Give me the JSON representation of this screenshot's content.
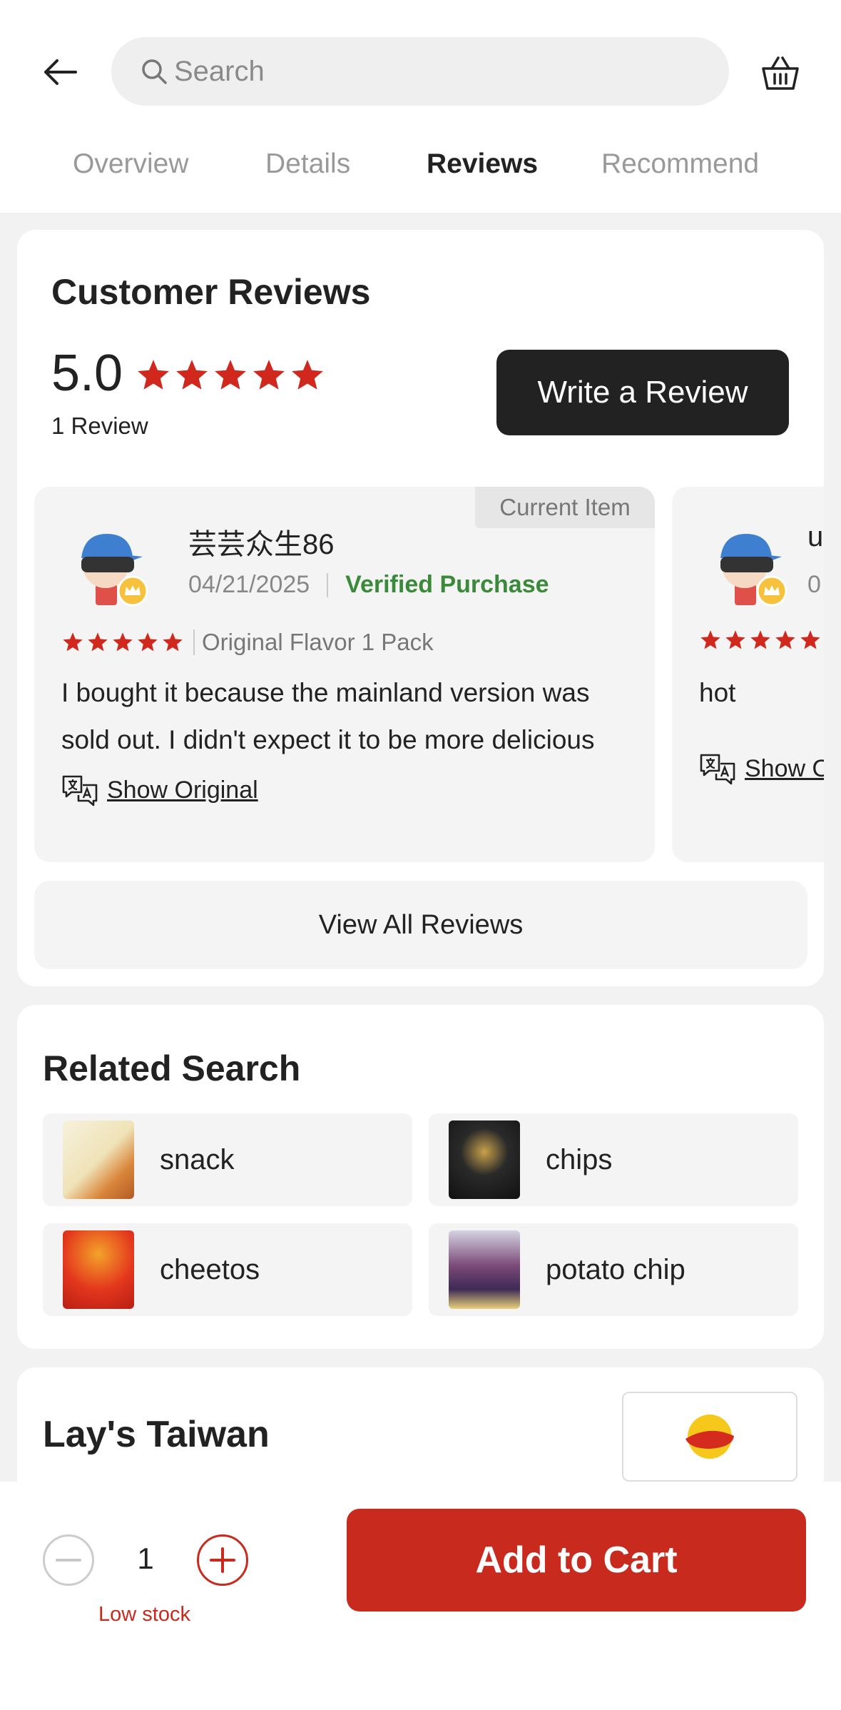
{
  "header": {
    "search_placeholder": "Search",
    "tabs": [
      {
        "label": "Overview",
        "active": false
      },
      {
        "label": "Details",
        "active": false
      },
      {
        "label": "Reviews",
        "active": true
      },
      {
        "label": "Recommend",
        "active": false
      }
    ]
  },
  "reviews": {
    "title": "Customer Reviews",
    "rating": "5.0",
    "rating_stars": 5,
    "count_label": "1 Review",
    "write_button": "Write a Review",
    "items": [
      {
        "tag": "Current Item",
        "name": "芸芸众生86",
        "date": "04/21/2025",
        "verified": "Verified Purchase",
        "stars": 5,
        "variant": "Original Flavor 1 Pack",
        "text": "I bought it because the mainland version was sold out. I didn't expect it to be more delicious",
        "show_original": "Show Original"
      },
      {
        "name": "u",
        "date": "0",
        "stars": 5,
        "text": "hot",
        "show_original": "Show O"
      }
    ],
    "view_all": "View All Reviews"
  },
  "related_search": {
    "title": "Related Search",
    "items": [
      {
        "label": "snack"
      },
      {
        "label": "chips"
      },
      {
        "label": "cheetos"
      },
      {
        "label": "potato chip"
      }
    ]
  },
  "brand": {
    "name": "Lay's Taiwan",
    "logo_text": "Lay's樂事"
  },
  "cart_bar": {
    "quantity": "1",
    "stock_note": "Low stock",
    "add_to_cart": "Add to Cart"
  },
  "colors": {
    "accent": "#c92a1e",
    "star": "#d0281c",
    "verified": "#3b8a3b",
    "dark_button": "#222222"
  }
}
